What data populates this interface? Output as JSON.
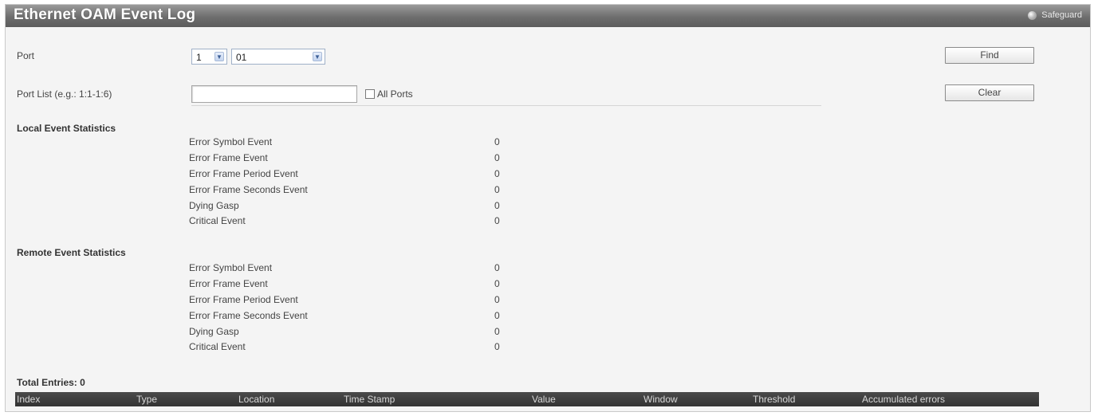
{
  "title": "Ethernet OAM Event Log",
  "safeguard_label": "Safeguard",
  "port": {
    "label": "Port",
    "unit_value": "1",
    "port_value": "01"
  },
  "port_list": {
    "label": "Port List (e.g.: 1:1-1:6)",
    "value": "",
    "all_ports_label": "All Ports"
  },
  "buttons": {
    "find": "Find",
    "clear": "Clear"
  },
  "local": {
    "title": "Local Event Statistics",
    "rows": [
      {
        "name": "Error Symbol Event",
        "value": "0"
      },
      {
        "name": "Error Frame Event",
        "value": "0"
      },
      {
        "name": "Error Frame Period Event",
        "value": "0"
      },
      {
        "name": "Error Frame Seconds Event",
        "value": "0"
      },
      {
        "name": "Dying Gasp",
        "value": "0"
      },
      {
        "name": "Critical Event",
        "value": "0"
      }
    ]
  },
  "remote": {
    "title": "Remote Event Statistics",
    "rows": [
      {
        "name": "Error Symbol Event",
        "value": "0"
      },
      {
        "name": "Error Frame Event",
        "value": "0"
      },
      {
        "name": "Error Frame Period Event",
        "value": "0"
      },
      {
        "name": "Error Frame Seconds Event",
        "value": "0"
      },
      {
        "name": "Dying Gasp",
        "value": "0"
      },
      {
        "name": "Critical Event",
        "value": "0"
      }
    ]
  },
  "total_entries": "Total Entries: 0",
  "table": {
    "columns": [
      "Index",
      "Type",
      "Location",
      "Time Stamp",
      "Value",
      "Window",
      "Threshold",
      "Accumulated errors"
    ]
  }
}
